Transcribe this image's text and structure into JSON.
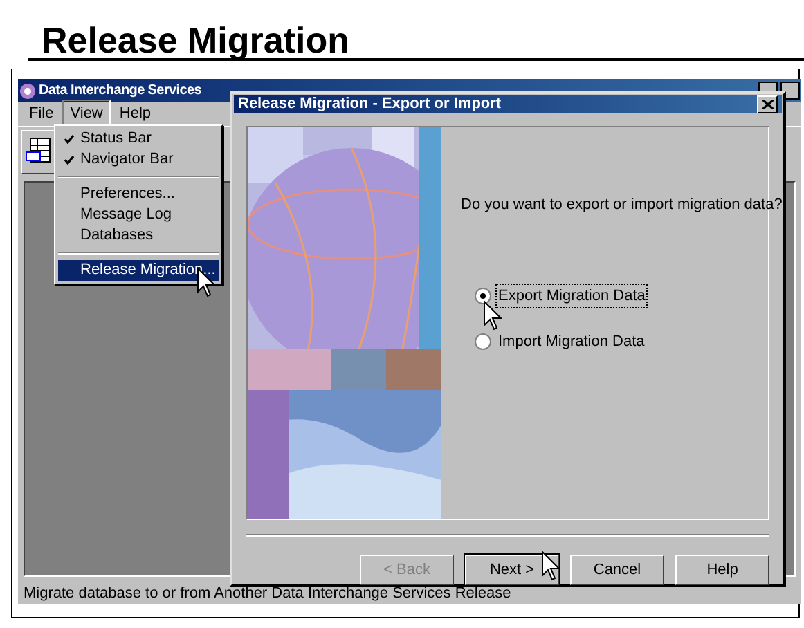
{
  "heading": "Release Migration",
  "app": {
    "title": "Data Interchange Services",
    "menus": [
      {
        "label": "File",
        "selected": false
      },
      {
        "label": "View",
        "selected": true
      },
      {
        "label": "Help",
        "selected": false
      }
    ],
    "view_menu": [
      {
        "kind": "check",
        "label": "Status Bar",
        "checked": true,
        "selected": false
      },
      {
        "kind": "check",
        "label": "Navigator Bar",
        "checked": true,
        "selected": false
      },
      {
        "kind": "separator"
      },
      {
        "kind": "item",
        "label": "Preferences...",
        "selected": false
      },
      {
        "kind": "item",
        "label": "Message Log",
        "selected": false
      },
      {
        "kind": "item",
        "label": "Databases",
        "selected": false
      },
      {
        "kind": "separator"
      },
      {
        "kind": "item",
        "label": "Release Migration...",
        "selected": true
      }
    ],
    "status_bar": "Migrate database to or from Another Data Interchange Services Release"
  },
  "dialog": {
    "title": "Release Migration - Export or Import",
    "question": "Do you want to export or import migration data?",
    "options": [
      {
        "label": "Export Migration Data",
        "selected": true
      },
      {
        "label": "Import Migration Data",
        "selected": false
      }
    ],
    "buttons": [
      {
        "label": "< Back",
        "disabled": true,
        "default": false
      },
      {
        "label": "Next >",
        "disabled": false,
        "default": true
      },
      {
        "label": "Cancel",
        "disabled": false,
        "default": false
      },
      {
        "label": "Help",
        "disabled": false,
        "default": false
      }
    ]
  }
}
